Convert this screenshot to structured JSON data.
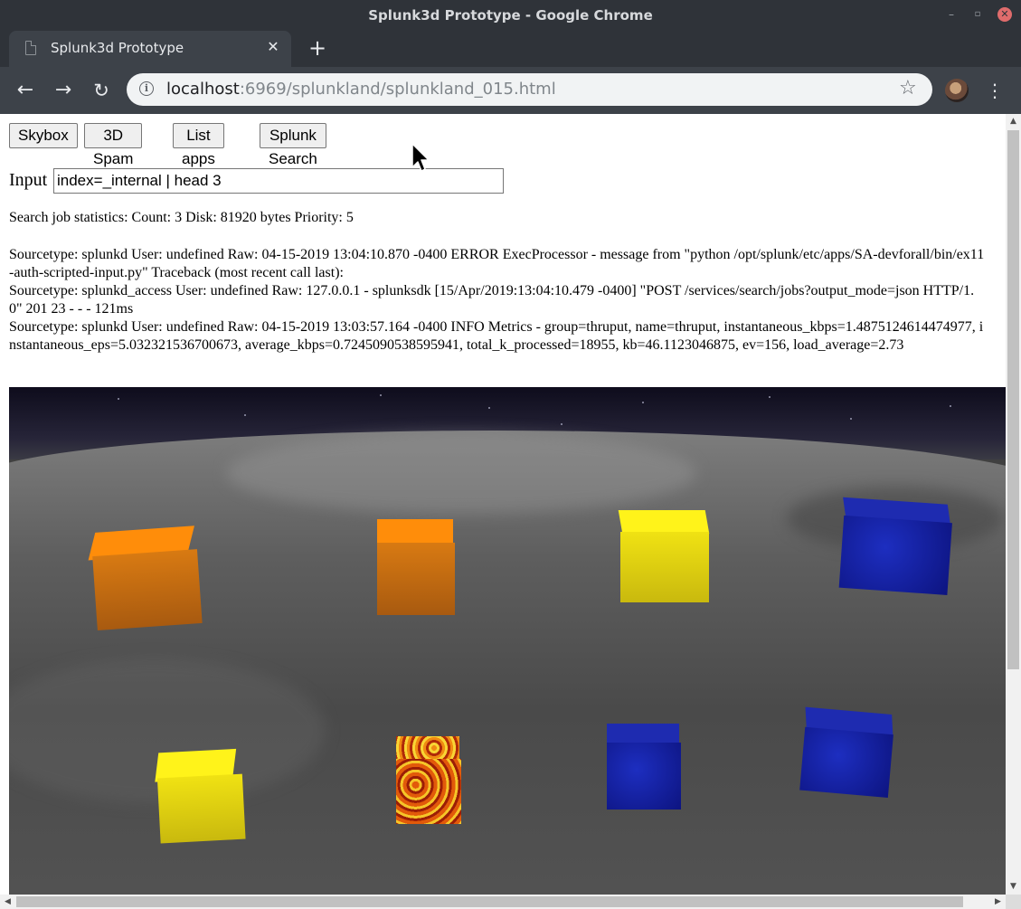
{
  "window": {
    "title": "Splunk3d Prototype - Google Chrome",
    "minimize_glyph": "–",
    "maximize_glyph": "▫",
    "close_glyph": "✕"
  },
  "tab": {
    "title": "Splunk3d Prototype",
    "close_glyph": "✕",
    "new_tab_glyph": "+"
  },
  "toolbar": {
    "back_glyph": "←",
    "forward_glyph": "→",
    "reload_glyph": "↻",
    "url_host": "localhost",
    "url_rest": ":6969/splunkland/splunkland_015.html",
    "info_glyph": "i",
    "star_glyph": "☆",
    "menu_glyph": "⋮"
  },
  "page": {
    "buttons": [
      "Skybox",
      "3D Spam",
      "List apps",
      "Splunk Search"
    ],
    "input_label": "Input",
    "input_value": "index=_internal | head 3",
    "stats": "Search job statistics: Count: 3 Disk: 81920 bytes Priority: 5",
    "results": [
      "Sourcetype: splunkd User: undefined Raw: 04-15-2019 13:04:10.870 -0400 ERROR ExecProcessor - message from \"python /opt/splunk/etc/apps/SA-devforall/bin/ex11-auth-scripted-input.py\" Traceback (most recent call last):",
      "Sourcetype: splunkd_access User: undefined Raw: 127.0.0.1 - splunksdk [15/Apr/2019:13:04:10.479 -0400] \"POST /services/search/jobs?output_mode=json HTTP/1.0\" 201 23 - - - 121ms",
      "Sourcetype: splunkd User: undefined Raw: 04-15-2019 13:03:57.164 -0400 INFO Metrics - group=thruput, name=thruput, instantaneous_kbps=1.4875124614474977, instantaneous_eps=5.032321536700673, average_kbps=0.7245090538595941, total_k_processed=18955, kb=46.1123046875, ev=156, load_average=2.73"
    ]
  },
  "scene": {
    "cubes": [
      {
        "color": "orange"
      },
      {
        "color": "orange"
      },
      {
        "color": "yellow"
      },
      {
        "color": "blue"
      },
      {
        "color": "yellow"
      },
      {
        "color": "lava"
      },
      {
        "color": "blue"
      },
      {
        "color": "blue"
      }
    ]
  },
  "scrollbars": {
    "up_glyph": "▲",
    "down_glyph": "▼",
    "left_glyph": "◀",
    "right_glyph": "▶"
  },
  "colors": {
    "chrome_frame": "#2f3339",
    "toolbar": "#3d4249",
    "omnibox": "#f1f3f4",
    "page_bg": "#ffffff"
  }
}
